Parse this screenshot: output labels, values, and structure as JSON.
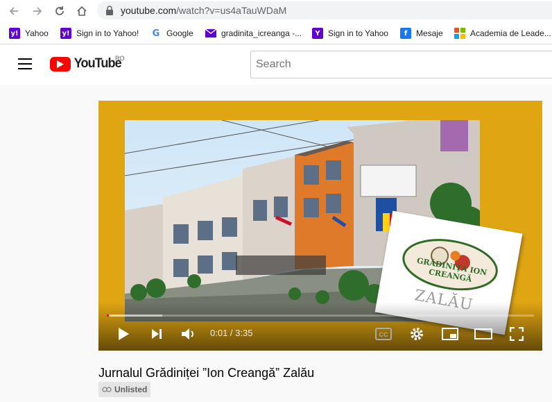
{
  "browser": {
    "url_host": "youtube.com",
    "url_path": "/watch?v=us4aTauWDaM"
  },
  "bookmarks": [
    {
      "label": "Yahoo",
      "icon": "yahoo-icon",
      "color": "#6001d2"
    },
    {
      "label": "Sign in to Yahoo!",
      "icon": "yahoo-icon",
      "color": "#6001d2"
    },
    {
      "label": "Google",
      "icon": "google-icon",
      "color": "#4285f4"
    },
    {
      "label": "gradinita_icreanga -...",
      "icon": "mail-icon",
      "color": "#6001d2"
    },
    {
      "label": "Sign in to Yahoo",
      "icon": "yahoo-icon",
      "color": "#6001d2"
    },
    {
      "label": "Mesaje",
      "icon": "facebook-icon",
      "color": "#1877f2"
    },
    {
      "label": "Academia de Leade...",
      "icon": "microsoft-icon",
      "color": "#f25022"
    }
  ],
  "youtube": {
    "logo_text": "YouTube",
    "country_code": "RO",
    "search_placeholder": "Search"
  },
  "thumbnail": {
    "card_line1": "GRĂDINIȚA ION CREANGĂ",
    "card_line2": "ZALĂU"
  },
  "player": {
    "current_time": "0:01",
    "duration": "3:35",
    "time_display": "0:01 / 3:35",
    "progress_fraction": 0.005,
    "loaded_fraction": 0.13
  },
  "video": {
    "title": "Jurnalul Grădiniței ”Ion Creangă” Zalău",
    "visibility": "Unlisted"
  },
  "colors": {
    "accent": "#ff0000",
    "frame": "#e0a512"
  }
}
